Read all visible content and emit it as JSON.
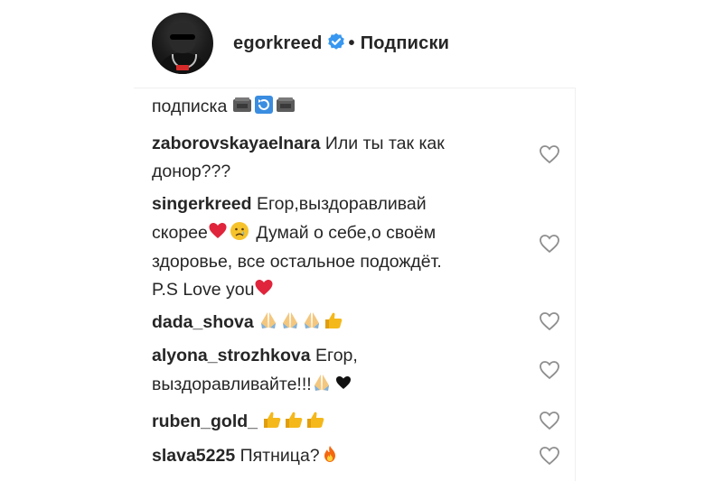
{
  "header": {
    "username": "egorkreed",
    "separator": "•",
    "follow_label": "Подписки"
  },
  "colors": {
    "text": "#262626",
    "verified": "#3897f0",
    "divider": "#efefef",
    "heart_outline": "#8e8e8e"
  },
  "comments": [
    {
      "username": "",
      "lines": [
        "подписка"
      ],
      "emoji": [
        "pot-of-food",
        "arrows-counterclockwise",
        "pot-of-food"
      ]
    },
    {
      "username": "zaborovskayaelnara",
      "lines": [
        "Или ты так как",
        "донор???"
      ]
    },
    {
      "username": "singerkreed",
      "lines": [
        "Егор,выздоравливай",
        "скорее",
        "Думай о себе,о своём",
        "здоровье, все остальное подождёт.",
        "P.S Love you"
      ]
    },
    {
      "username": "dada_shova",
      "emoji": [
        "folded-hands",
        "folded-hands",
        "folded-hands",
        "thumbs-up"
      ]
    },
    {
      "username": "alyona_strozhkova",
      "lines": [
        "Егор,",
        "выздоравливайте!!!"
      ],
      "emoji": [
        "folded-hands",
        "black-heart"
      ]
    },
    {
      "username": "ruben_gold_",
      "emoji": [
        "thumbs-up",
        "thumbs-up",
        "thumbs-up"
      ]
    },
    {
      "username": "slava5225",
      "lines": [
        "Пятница?"
      ],
      "emoji": [
        "fire"
      ]
    }
  ]
}
